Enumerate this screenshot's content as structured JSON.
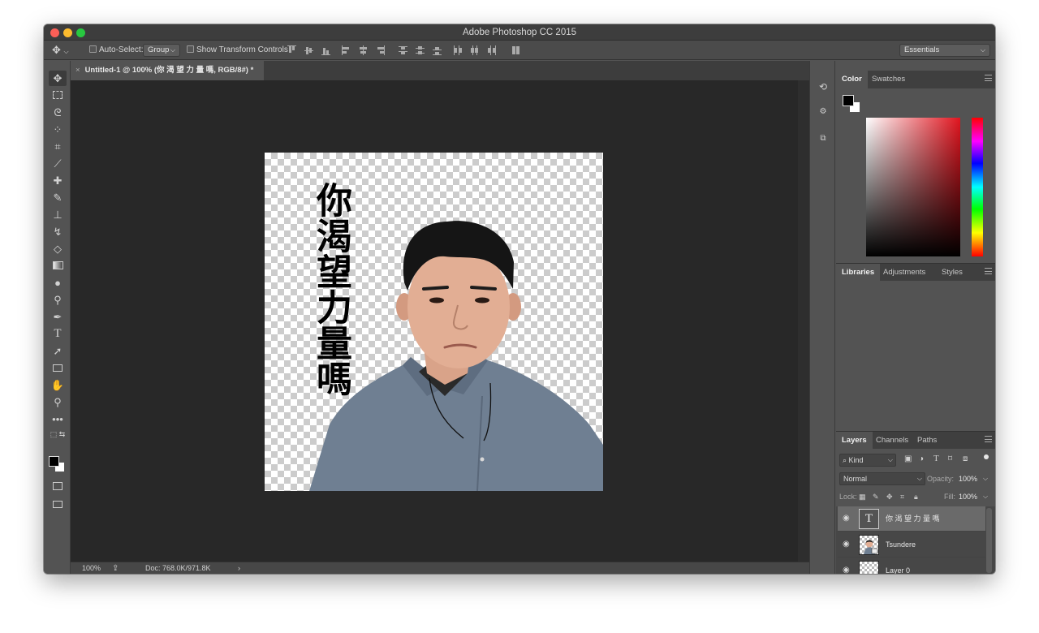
{
  "window": {
    "title": "Adobe Photoshop CC 2015"
  },
  "options_bar": {
    "auto_select_label": "Auto-Select:",
    "auto_select_value": "Group",
    "show_transform_label": "Show Transform Controls",
    "workspace": "Essentials"
  },
  "document": {
    "tab_title": "Untitled-1 @ 100% (你 渴 望 力 量 嗎, RGB/8#) *",
    "canvas_text": "你渴望力量嗎",
    "zoom": "100%",
    "doc_size": "Doc: 768.0K/971.8K"
  },
  "panels": {
    "color_tabs": [
      "Color",
      "Swatches"
    ],
    "library_tabs": [
      "Libraries",
      "Adjustments",
      "Styles"
    ],
    "layers_tabs": [
      "Layers",
      "Channels",
      "Paths"
    ],
    "filter_kind": "Kind",
    "blend_mode": "Normal",
    "opacity_label": "Opacity:",
    "opacity_value": "100%",
    "lock_label": "Lock:",
    "fill_label": "Fill:",
    "fill_value": "100%",
    "foreground_color": "#000000",
    "background_color": "#ffffff"
  },
  "layers": [
    {
      "name": "你 渴 望 力 量 嗎",
      "type": "text",
      "selected": true
    },
    {
      "name": "Tsundere",
      "type": "smart-object",
      "selected": false
    },
    {
      "name": "Layer 0",
      "type": "pixel",
      "selected": false
    }
  ]
}
